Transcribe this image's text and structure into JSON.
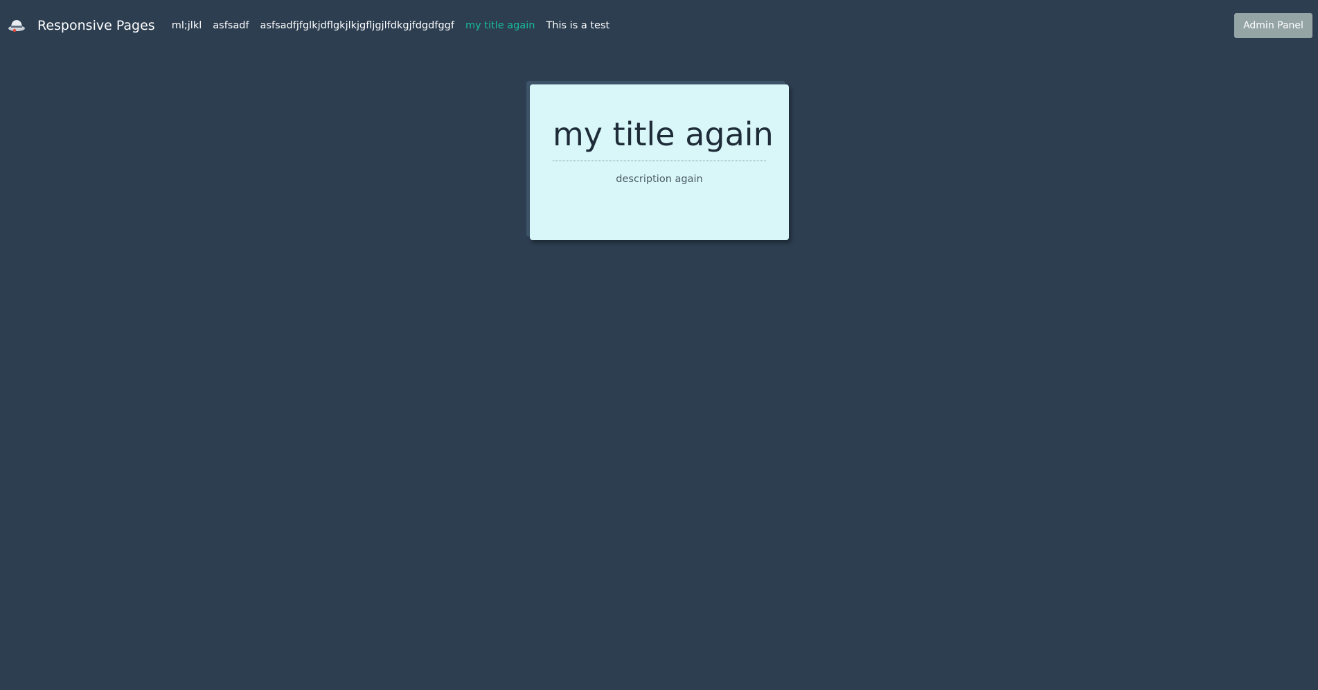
{
  "navbar": {
    "brand": {
      "icon": "hat-logo-icon",
      "name": "Responsive Pages"
    },
    "links": [
      {
        "label": "ml;jlkl",
        "active": false
      },
      {
        "label": "asfsadf",
        "active": false
      },
      {
        "label": "asfsadfjfglkjdflgkjlkjgfljgjlfdkgjfdgdfggf",
        "active": false
      },
      {
        "label": "my title again",
        "active": true
      },
      {
        "label": "This is a test",
        "active": false
      }
    ],
    "admin_button": "Admin Panel"
  },
  "card": {
    "title": "my title again",
    "description": "description again"
  },
  "colors": {
    "background": "#2c3e50",
    "active_link": "#1abc9c",
    "card_background": "#d9f7f8",
    "admin_button": "#95a5a6"
  }
}
